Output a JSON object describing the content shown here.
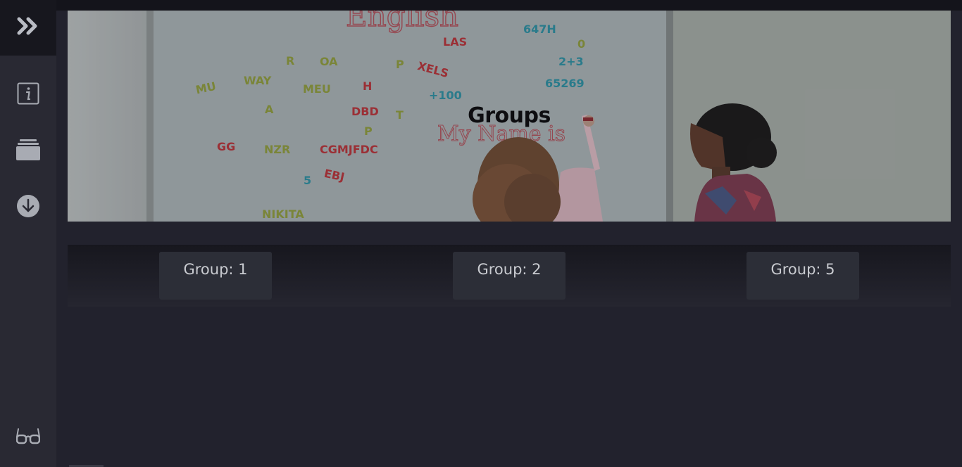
{
  "sidebar": {
    "expand_icon": "double-chevron-right-icon",
    "items": [
      {
        "name": "info",
        "icon": "info-icon"
      },
      {
        "name": "stack",
        "icon": "layers-icon"
      },
      {
        "name": "download",
        "icon": "download-icon"
      }
    ],
    "bottom_icon": "glasses-icon"
  },
  "hero": {
    "title": "Groups",
    "board_heading": "English",
    "board_handwriting": "My Name is",
    "board_numbers": [
      "647H",
      "0",
      "2+3",
      "65269",
      "+100"
    ],
    "board_letters": [
      "LAS",
      "R",
      "OA",
      "P",
      "XELS",
      "MU",
      "WAY",
      "MEU",
      "H",
      "A",
      "DBD",
      "T",
      "P",
      "GG",
      "NZR",
      "CGMJFDC",
      "5",
      "EBJ",
      "NIKITA"
    ]
  },
  "groups": [
    {
      "label": "Group: 1"
    },
    {
      "label": "Group: 2"
    },
    {
      "label": "Group: 5"
    }
  ],
  "colors": {
    "background": "#22222d",
    "sidebar": "#292933",
    "sidebar_top": "#17171e",
    "button": "#2c2e37",
    "button_text": "#c9cbd0"
  }
}
